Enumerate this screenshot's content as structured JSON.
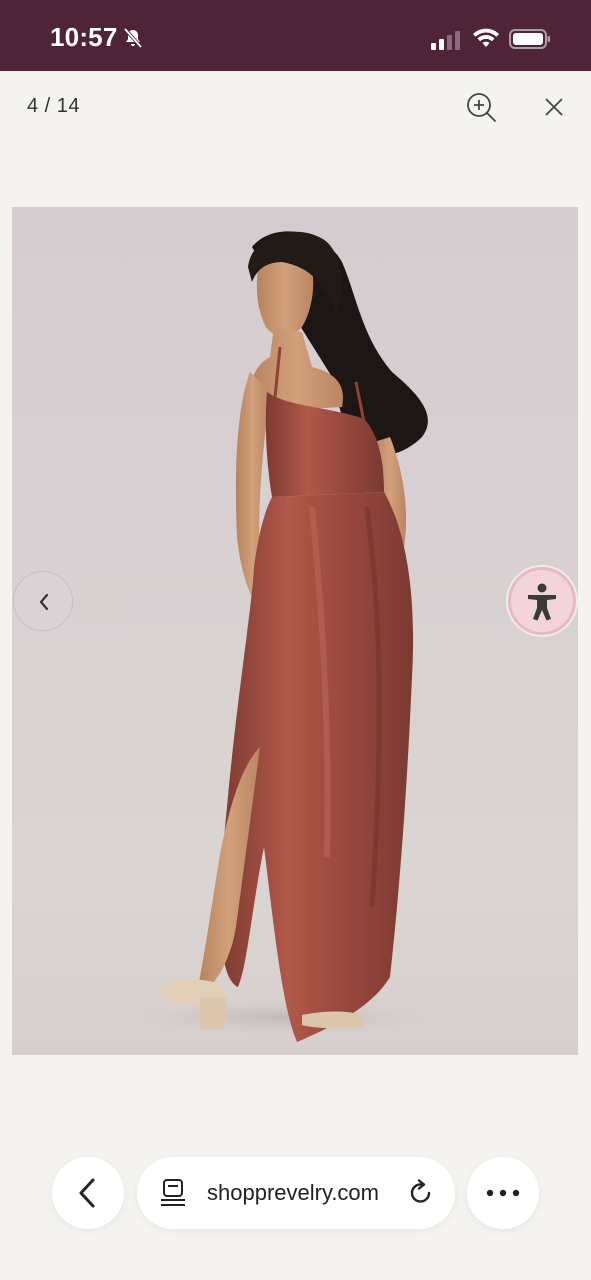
{
  "status_bar": {
    "time": "10:57",
    "icons": [
      "bell-muted-icon",
      "signal-icon",
      "wifi-icon",
      "battery-icon"
    ],
    "background": "#4f2338"
  },
  "viewer": {
    "counter": "4 / 14",
    "icons": [
      "zoom-in-icon",
      "close-icon"
    ]
  },
  "image": {
    "subject": "product photo",
    "colors": {
      "background": "#d6cfd0",
      "dress": "#9c4a3e"
    }
  },
  "controls": {
    "prev_icon": "chevron-left-icon",
    "accessibility_icon": "accessibility-person-icon",
    "accessibility_color": "#f3d4da"
  },
  "browser": {
    "url": "shopprevelry.com",
    "icons": [
      "back-arrow-icon",
      "page-icon",
      "reload-icon",
      "more-dots-icon"
    ]
  }
}
